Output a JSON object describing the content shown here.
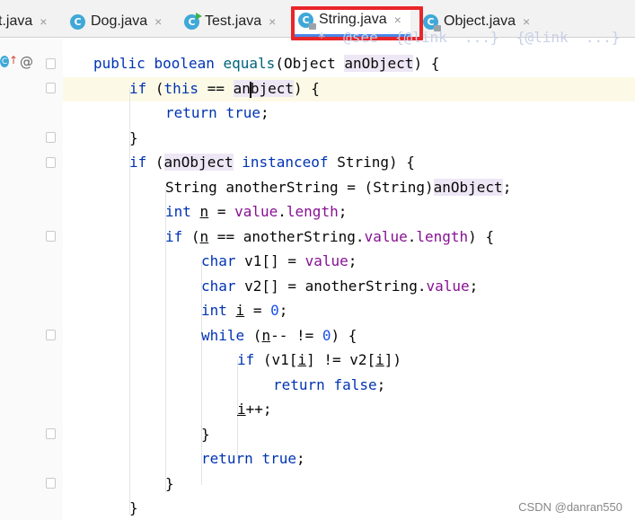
{
  "tabs": [
    {
      "label": "t.java",
      "close": "×"
    },
    {
      "label": "Dog.java",
      "close": "×",
      "icon": "C"
    },
    {
      "label": "Test.java",
      "close": "×",
      "icon": "C"
    },
    {
      "label": "String.java",
      "close": "×",
      "icon": "C",
      "active": true
    },
    {
      "label": "Object.java",
      "close": "×",
      "icon": "C"
    }
  ],
  "gutter": {
    "class_icon": "C",
    "override_arrow": "↑",
    "annotation": "@"
  },
  "code": {
    "l1": {
      "kw1": "public",
      "kw2": "boolean",
      "name": "equals",
      "open": "(Object ",
      "param": "anObject",
      "close": ") {"
    },
    "l2": {
      "kw": "if",
      "a": " (",
      "this": "this",
      "b": " == ",
      "p1": "an",
      "p2": "bject",
      "c": ") {"
    },
    "l3": {
      "kw": "return",
      "sp": " ",
      "val": "true",
      "end": ";"
    },
    "l4": "}",
    "l5": {
      "kw": "if",
      "a": " (",
      "param": "anObject",
      "sp": " ",
      "kw2": "instanceof",
      "b": " String) {"
    },
    "l6": {
      "a": "String anotherString = (String)",
      "param": "anObject",
      "end": ";"
    },
    "l7": {
      "kw": "int",
      "sp": " ",
      "n": "n",
      "a": " = ",
      "field": "value",
      "b": ".",
      "field2": "length",
      "end": ";"
    },
    "l8": {
      "kw": "if",
      "a": " (",
      "n": "n",
      "b": " == anotherString.",
      "field": "value",
      "c": ".",
      "field2": "length",
      "end": ") {"
    },
    "l9": {
      "kw": "char",
      "a": " v1[] = ",
      "field": "value",
      "end": ";"
    },
    "l10": {
      "kw": "char",
      "a": " v2[] = anotherString.",
      "field": "value",
      "end": ";"
    },
    "l11": {
      "kw": "int",
      "sp": " ",
      "i": "i",
      "a": " = ",
      "num": "0",
      "end": ";"
    },
    "l12": {
      "kw": "while",
      "a": " (",
      "n": "n",
      "b": "-- != ",
      "num": "0",
      "end": ") {"
    },
    "l13": {
      "kw": "if",
      "a": " (v1[",
      "i1": "i",
      "b": "] != v2[",
      "i2": "i",
      "end": "])"
    },
    "l14": {
      "kw": "return",
      "sp": " ",
      "val": "false",
      "end": ";"
    },
    "l15": {
      "i": "i",
      "end": "++;"
    },
    "l16": "}",
    "l17": {
      "kw": "return",
      "sp": " ",
      "val": "true",
      "end": ";"
    },
    "l18": "}",
    "l19": "}"
  },
  "watermark": "CSDN @danran550"
}
